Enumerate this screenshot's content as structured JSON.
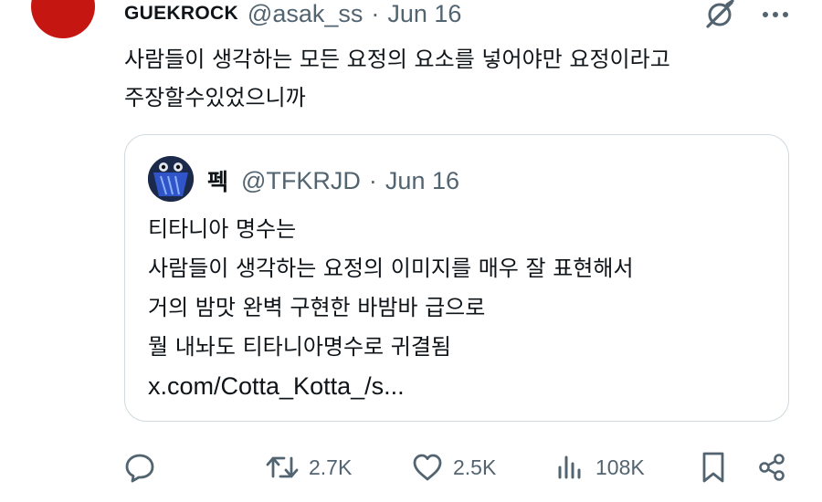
{
  "tweet": {
    "author_name": "GUEKROCK",
    "author_handle": "@asak_ss",
    "separator": "·",
    "date": "Jun 16",
    "text_lines": [
      "사람들이 생각하는 모든 요정의 요소를 넣어야만 요정이라고",
      "주장할수있었으니까"
    ],
    "avatar_color": "#c51612"
  },
  "quote": {
    "author_name": "펙",
    "author_handle": "@TFKRJD",
    "separator": "·",
    "date": "Jun 16",
    "text_lines": [
      "티타니아 명수는",
      "사람들이 생각하는 요정의 이미지를 매우 잘 표현해서",
      "거의 밤맛 완벽 구현한 바밤바 급으로",
      "뭘 내놔도 티타니아명수로 귀결됨"
    ],
    "link": "x.com/Cotta_Kotta_/s..."
  },
  "actions": {
    "replies": {
      "icon": "reply-icon"
    },
    "retweets": {
      "icon": "retweet-icon",
      "count": "2.7K"
    },
    "likes": {
      "icon": "heart-icon",
      "count": "2.5K"
    },
    "views": {
      "icon": "views-icon",
      "count": "108K"
    },
    "bookmark": {
      "icon": "bookmark-icon"
    },
    "share": {
      "icon": "share-icon"
    }
  },
  "top_icons": [
    "grok-icon",
    "more-icon"
  ],
  "colors": {
    "text": "#0f1419",
    "secondary": "#536471",
    "border": "#cfd9de"
  }
}
